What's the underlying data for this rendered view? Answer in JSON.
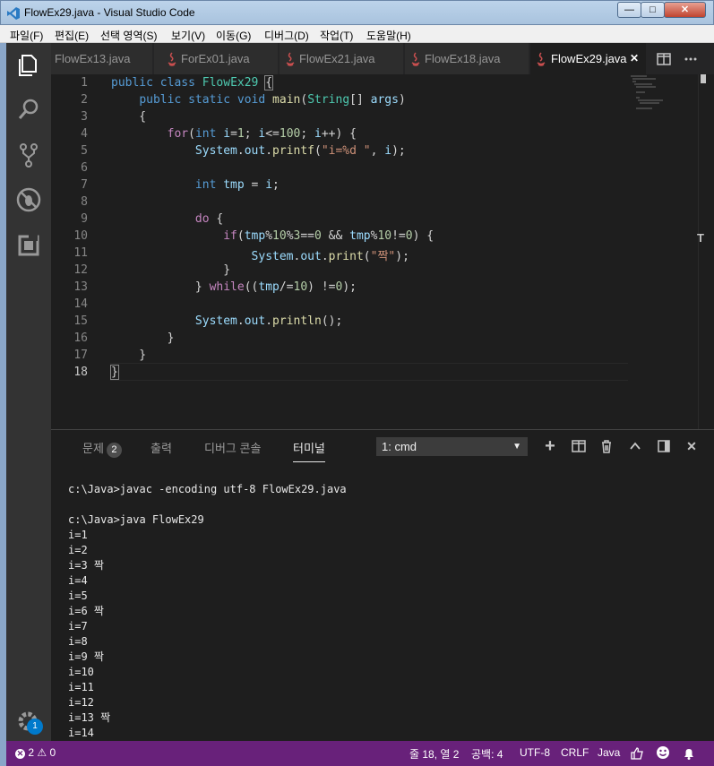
{
  "window": {
    "title": "FlowEx29.java - Visual Studio Code",
    "min": "—",
    "max": "□",
    "close": "✕"
  },
  "menu": [
    "파일(F)",
    "편집(E)",
    "선택 영역(S)",
    "보기(V)",
    "이동(G)",
    "디버그(D)",
    "작업(T)",
    "도움말(H)"
  ],
  "tabs": [
    {
      "label": "FlowEx13.java"
    },
    {
      "label": "ForEx01.java"
    },
    {
      "label": "FlowEx21.java"
    },
    {
      "label": "FlowEx18.java"
    },
    {
      "label": "FlowEx29.java"
    }
  ],
  "tab_close": "✕",
  "editor": {
    "line_numbers": [
      "1",
      "2",
      "3",
      "4",
      "5",
      "6",
      "7",
      "8",
      "9",
      "10",
      "11",
      "12",
      "13",
      "14",
      "15",
      "16",
      "17",
      "18"
    ]
  },
  "panel": {
    "tabs": [
      "문제",
      "출력",
      "디버그 콘솔",
      "터미널"
    ],
    "problems_count": "2",
    "terminal_select": "1: cmd",
    "select_arrow": "▼",
    "add": "+",
    "split": "◫",
    "trash": "🗑",
    "up": "⌃",
    "maximize": "◧",
    "close": "✕"
  },
  "terminal": {
    "lines": [
      "c:\\Java>javac -encoding utf-8 FlowEx29.java",
      "",
      "c:\\Java>java FlowEx29",
      "i=1",
      "i=2",
      "i=3 짝",
      "i=4",
      "i=5",
      "i=6 짝",
      "i=7",
      "i=8",
      "i=9 짝",
      "i=10",
      "i=11",
      "i=12",
      "i=13 짝",
      "i=14"
    ]
  },
  "status": {
    "errors": "2",
    "warnings": "0",
    "position": "줄 18, 열 2",
    "spaces": "공백: 4",
    "encoding": "UTF-8",
    "eol": "CRLF",
    "language": "Java",
    "settings_badge": "1"
  },
  "colors": {
    "statusbar": "#68217a",
    "editor_bg": "#1e1e1e",
    "activity_bg": "#333333",
    "keyword": "#569cd6",
    "control": "#c586c0",
    "type": "#4ec9b0",
    "string": "#ce9178",
    "number": "#b5cea8"
  }
}
